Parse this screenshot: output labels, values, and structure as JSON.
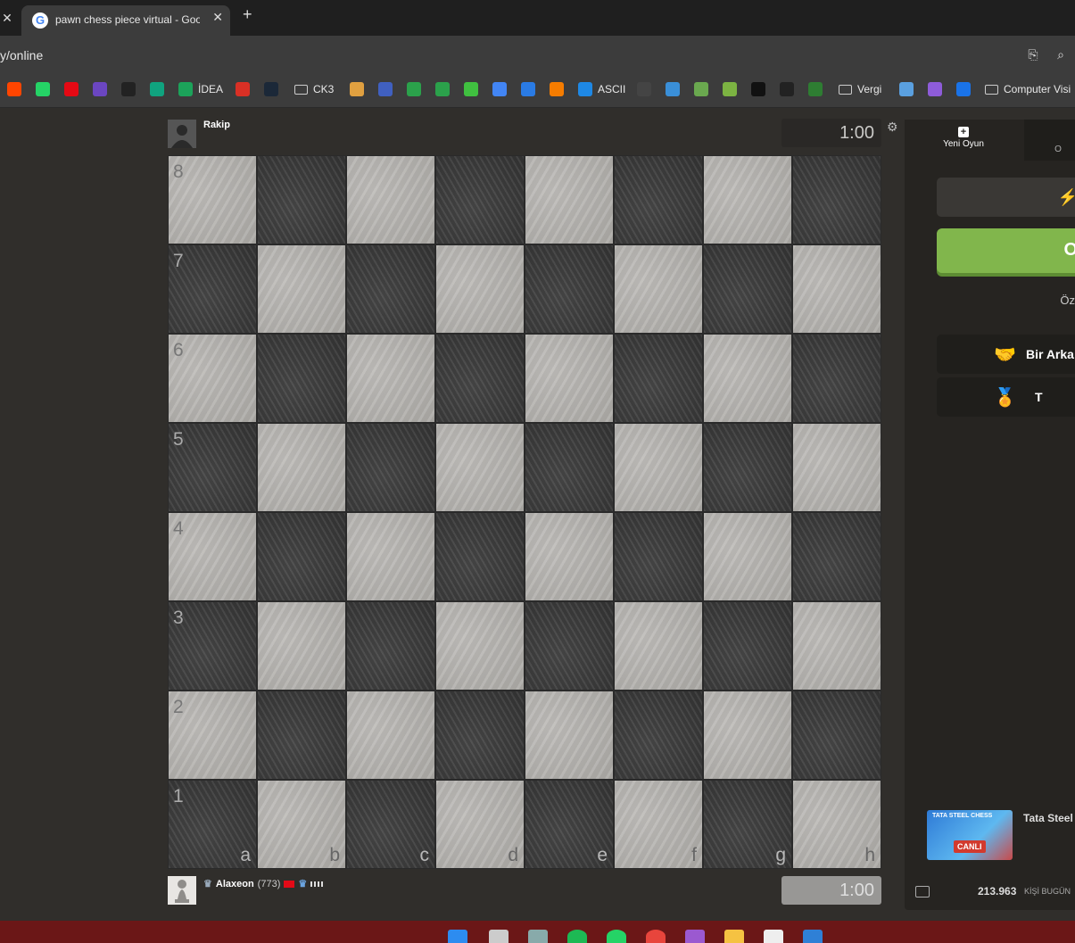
{
  "browser": {
    "tab_close_left": "✕",
    "tab_favicon": "G",
    "tab_title": "pawn chess piece virtual - Goog",
    "tab_close": "✕",
    "new_tab": "+",
    "address": "y/online",
    "bookmarks": [
      {
        "label": "",
        "color": "#ff4500"
      },
      {
        "label": "",
        "color": "#25d366"
      },
      {
        "label": "",
        "color": "#e50914"
      },
      {
        "label": "",
        "color": "#6b46c1"
      },
      {
        "label": "",
        "color": "#222222"
      },
      {
        "label": "",
        "color": "#10a37f"
      },
      {
        "label": "İDEA",
        "color": "#1ca35a"
      },
      {
        "label": "",
        "color": "#d93025"
      },
      {
        "label": "",
        "color": "#1b2838"
      },
      {
        "label": "CK3",
        "folder": true
      },
      {
        "label": "",
        "color": "#e0a040"
      },
      {
        "label": "",
        "color": "#4060c0"
      },
      {
        "label": "",
        "color": "#2ba14b"
      },
      {
        "label": "",
        "color": "#2ba14b"
      },
      {
        "label": "",
        "color": "#40c040"
      },
      {
        "label": "",
        "color": "#4285f4"
      },
      {
        "label": "",
        "color": "#2a7be4"
      },
      {
        "label": "",
        "color": "#f57c00"
      },
      {
        "label": "ASCII",
        "color": "#1e88e5"
      },
      {
        "label": "",
        "color": "#444444"
      },
      {
        "label": "",
        "color": "#3a8fd8"
      },
      {
        "label": "",
        "color": "#6aa84f"
      },
      {
        "label": "",
        "color": "#7cb342"
      },
      {
        "label": "",
        "color": "#111111"
      },
      {
        "label": "",
        "color": "#222222"
      },
      {
        "label": "",
        "color": "#2e7d32"
      },
      {
        "label": "Vergi",
        "folder": true
      },
      {
        "label": "",
        "color": "#5aa0e0"
      },
      {
        "label": "",
        "color": "#8e5cd9"
      },
      {
        "label": "",
        "color": "#1a73e8"
      },
      {
        "label": "Computer Visi",
        "folder": true
      }
    ]
  },
  "game": {
    "opponent_name": "Rakip",
    "opponent_clock": "1:00",
    "user_name": "Alaxeon",
    "user_rating": "(773)",
    "user_clock": "1:00",
    "files": [
      "a",
      "b",
      "c",
      "d",
      "e",
      "f",
      "g",
      "h"
    ],
    "ranks": [
      "8",
      "7",
      "6",
      "5",
      "4",
      "3",
      "2",
      "1"
    ]
  },
  "panel": {
    "tab_new_game": "Yeni Oyun",
    "tab_other": "O",
    "play_button": "O",
    "custom_label": "Öz",
    "friend_button": "Bir Arka",
    "tournament_button": "T",
    "promo_image_title": "TATA STEEL CHESS",
    "promo_live": "CANLI",
    "promo_text": "Tata Steel",
    "players_count": "213.963",
    "players_label": "KİŞİ BUGÜN"
  }
}
